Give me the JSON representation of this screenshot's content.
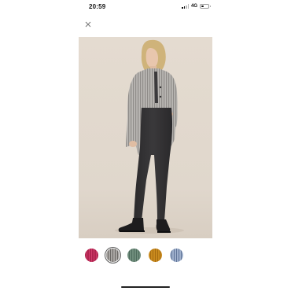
{
  "status_bar": {
    "time": "20:59",
    "network": "4G",
    "signal_icon": "cellular-signal",
    "battery_icon": "battery-low"
  },
  "close_icon": "close-x",
  "product": {
    "image_description_icon": "product-photo"
  },
  "swatches": [
    {
      "name": "swatch-magenta",
      "color": "#b0244f",
      "stripe": "#d23e6d",
      "selected": false
    },
    {
      "name": "swatch-grey-stripe",
      "color": "#a9a6a3",
      "stripe": "#6c6966",
      "selected": true
    },
    {
      "name": "swatch-green-stripe",
      "color": "#6f8d7c",
      "stripe": "#4d6b5c",
      "selected": false
    },
    {
      "name": "swatch-mustard",
      "color": "#c98a1e",
      "stripe": "#a66c10",
      "selected": false
    },
    {
      "name": "swatch-blue-stripe",
      "color": "#9fb0cc",
      "stripe": "#5f7397",
      "selected": false
    }
  ]
}
